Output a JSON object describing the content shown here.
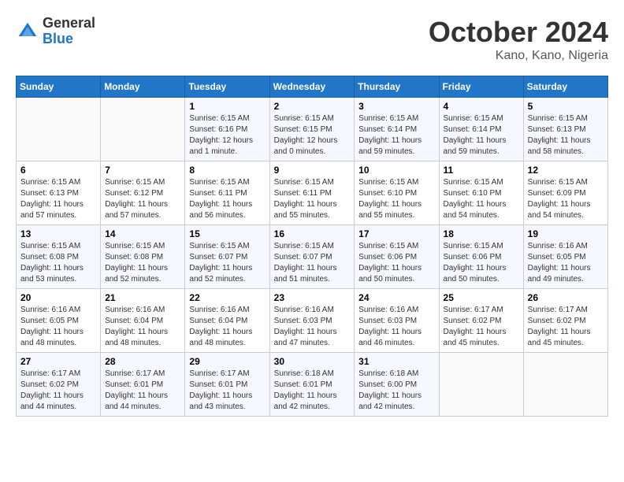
{
  "logo": {
    "general": "General",
    "blue": "Blue"
  },
  "header": {
    "month": "October 2024",
    "location": "Kano, Kano, Nigeria"
  },
  "weekdays": [
    "Sunday",
    "Monday",
    "Tuesday",
    "Wednesday",
    "Thursday",
    "Friday",
    "Saturday"
  ],
  "weeks": [
    [
      {
        "day": null
      },
      {
        "day": null
      },
      {
        "day": "1",
        "sunrise": "6:15 AM",
        "sunset": "6:16 PM",
        "daylight": "12 hours and 1 minute."
      },
      {
        "day": "2",
        "sunrise": "6:15 AM",
        "sunset": "6:15 PM",
        "daylight": "12 hours and 0 minutes."
      },
      {
        "day": "3",
        "sunrise": "6:15 AM",
        "sunset": "6:14 PM",
        "daylight": "11 hours and 59 minutes."
      },
      {
        "day": "4",
        "sunrise": "6:15 AM",
        "sunset": "6:14 PM",
        "daylight": "11 hours and 59 minutes."
      },
      {
        "day": "5",
        "sunrise": "6:15 AM",
        "sunset": "6:13 PM",
        "daylight": "11 hours and 58 minutes."
      }
    ],
    [
      {
        "day": "6",
        "sunrise": "6:15 AM",
        "sunset": "6:13 PM",
        "daylight": "11 hours and 57 minutes."
      },
      {
        "day": "7",
        "sunrise": "6:15 AM",
        "sunset": "6:12 PM",
        "daylight": "11 hours and 57 minutes."
      },
      {
        "day": "8",
        "sunrise": "6:15 AM",
        "sunset": "6:11 PM",
        "daylight": "11 hours and 56 minutes."
      },
      {
        "day": "9",
        "sunrise": "6:15 AM",
        "sunset": "6:11 PM",
        "daylight": "11 hours and 55 minutes."
      },
      {
        "day": "10",
        "sunrise": "6:15 AM",
        "sunset": "6:10 PM",
        "daylight": "11 hours and 55 minutes."
      },
      {
        "day": "11",
        "sunrise": "6:15 AM",
        "sunset": "6:10 PM",
        "daylight": "11 hours and 54 minutes."
      },
      {
        "day": "12",
        "sunrise": "6:15 AM",
        "sunset": "6:09 PM",
        "daylight": "11 hours and 54 minutes."
      }
    ],
    [
      {
        "day": "13",
        "sunrise": "6:15 AM",
        "sunset": "6:08 PM",
        "daylight": "11 hours and 53 minutes."
      },
      {
        "day": "14",
        "sunrise": "6:15 AM",
        "sunset": "6:08 PM",
        "daylight": "11 hours and 52 minutes."
      },
      {
        "day": "15",
        "sunrise": "6:15 AM",
        "sunset": "6:07 PM",
        "daylight": "11 hours and 52 minutes."
      },
      {
        "day": "16",
        "sunrise": "6:15 AM",
        "sunset": "6:07 PM",
        "daylight": "11 hours and 51 minutes."
      },
      {
        "day": "17",
        "sunrise": "6:15 AM",
        "sunset": "6:06 PM",
        "daylight": "11 hours and 50 minutes."
      },
      {
        "day": "18",
        "sunrise": "6:15 AM",
        "sunset": "6:06 PM",
        "daylight": "11 hours and 50 minutes."
      },
      {
        "day": "19",
        "sunrise": "6:16 AM",
        "sunset": "6:05 PM",
        "daylight": "11 hours and 49 minutes."
      }
    ],
    [
      {
        "day": "20",
        "sunrise": "6:16 AM",
        "sunset": "6:05 PM",
        "daylight": "11 hours and 48 minutes."
      },
      {
        "day": "21",
        "sunrise": "6:16 AM",
        "sunset": "6:04 PM",
        "daylight": "11 hours and 48 minutes."
      },
      {
        "day": "22",
        "sunrise": "6:16 AM",
        "sunset": "6:04 PM",
        "daylight": "11 hours and 48 minutes."
      },
      {
        "day": "23",
        "sunrise": "6:16 AM",
        "sunset": "6:03 PM",
        "daylight": "11 hours and 47 minutes."
      },
      {
        "day": "24",
        "sunrise": "6:16 AM",
        "sunset": "6:03 PM",
        "daylight": "11 hours and 46 minutes."
      },
      {
        "day": "25",
        "sunrise": "6:17 AM",
        "sunset": "6:02 PM",
        "daylight": "11 hours and 45 minutes."
      },
      {
        "day": "26",
        "sunrise": "6:17 AM",
        "sunset": "6:02 PM",
        "daylight": "11 hours and 45 minutes."
      }
    ],
    [
      {
        "day": "27",
        "sunrise": "6:17 AM",
        "sunset": "6:02 PM",
        "daylight": "11 hours and 44 minutes."
      },
      {
        "day": "28",
        "sunrise": "6:17 AM",
        "sunset": "6:01 PM",
        "daylight": "11 hours and 44 minutes."
      },
      {
        "day": "29",
        "sunrise": "6:17 AM",
        "sunset": "6:01 PM",
        "daylight": "11 hours and 43 minutes."
      },
      {
        "day": "30",
        "sunrise": "6:18 AM",
        "sunset": "6:01 PM",
        "daylight": "11 hours and 42 minutes."
      },
      {
        "day": "31",
        "sunrise": "6:18 AM",
        "sunset": "6:00 PM",
        "daylight": "11 hours and 42 minutes."
      },
      {
        "day": null
      },
      {
        "day": null
      }
    ]
  ],
  "labels": {
    "sunrise_prefix": "Sunrise: ",
    "sunset_prefix": "Sunset: ",
    "daylight_prefix": "Daylight: "
  }
}
